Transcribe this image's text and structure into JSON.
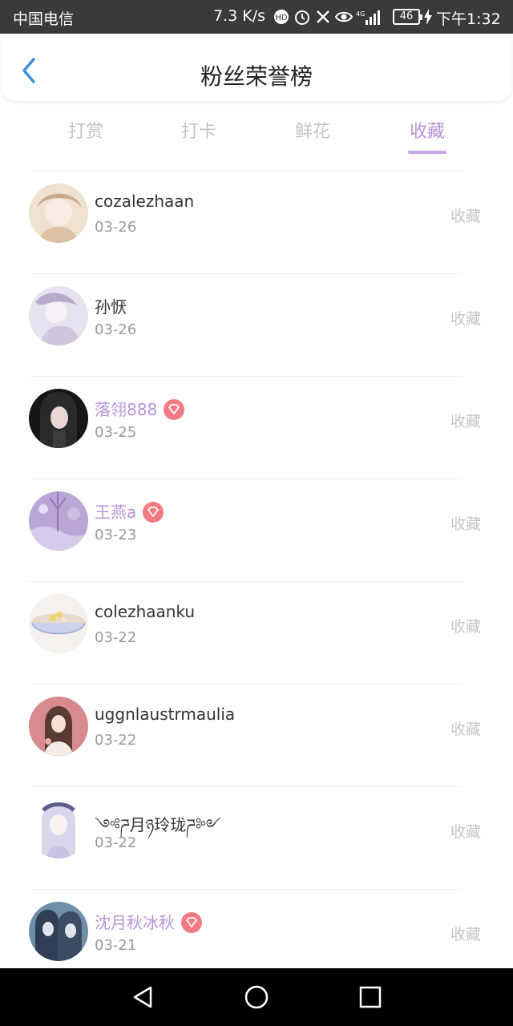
{
  "status_bar": {
    "carrier": "中国电信",
    "speed": "7.3 K/s",
    "battery": "46",
    "time": "下午1:32"
  },
  "header": {
    "title": "粉丝荣誉榜"
  },
  "tabs": [
    {
      "label": "打赏",
      "active": false
    },
    {
      "label": "打卡",
      "active": false
    },
    {
      "label": "鲜花",
      "active": false
    },
    {
      "label": "收藏",
      "active": true
    }
  ],
  "colors": {
    "accent": "#b694d9",
    "vip_badge": "#f07b83",
    "status_bar_bg": "#3a3a3a"
  },
  "fans": [
    {
      "name": "cozalezhaan",
      "date": "03-26",
      "action": "收藏",
      "vip": false
    },
    {
      "name": "孙恹",
      "date": "03-26",
      "action": "收藏",
      "vip": false
    },
    {
      "name": "落翎888",
      "date": "03-25",
      "action": "收藏",
      "vip": true
    },
    {
      "name": "王燕a",
      "date": "03-23",
      "action": "收藏",
      "vip": true
    },
    {
      "name": "colezhaanku",
      "date": "03-22",
      "action": "收藏",
      "vip": false
    },
    {
      "name": "uggnlaustrmaulia",
      "date": "03-22",
      "action": "收藏",
      "vip": false
    },
    {
      "name": "༺ཌ月ཉ玲珑ཌ༻",
      "date": "03-22",
      "action": "收藏",
      "vip": false
    },
    {
      "name": "沈月秋冰秋",
      "date": "03-21",
      "action": "收藏",
      "vip": true
    }
  ]
}
